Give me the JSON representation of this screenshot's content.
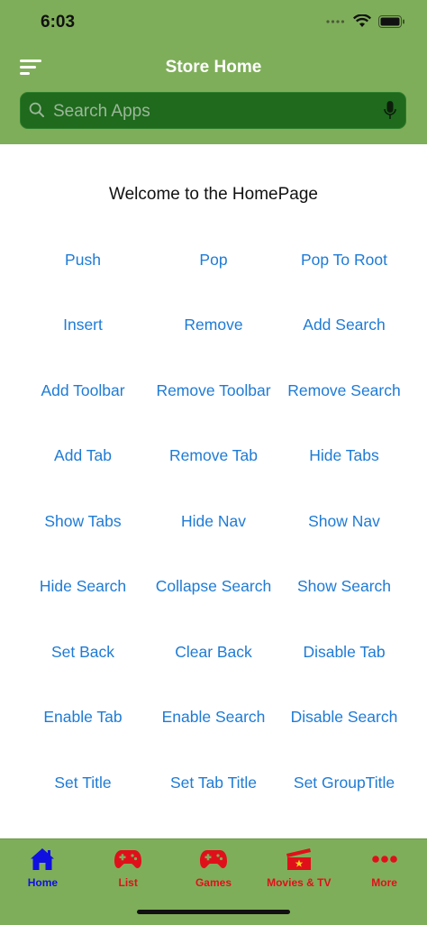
{
  "status_bar": {
    "time": "6:03"
  },
  "header": {
    "title": "Store Home",
    "search": {
      "placeholder": "Search Apps",
      "value": ""
    }
  },
  "main": {
    "welcome": "Welcome to the HomePage",
    "buttons": [
      [
        "Push",
        "Pop",
        "Pop To Root"
      ],
      [
        "Insert",
        "Remove",
        "Add Search"
      ],
      [
        "Add Toolbar",
        "Remove Toolbar",
        "Remove Search"
      ],
      [
        "Add Tab",
        "Remove Tab",
        "Hide Tabs"
      ],
      [
        "Show Tabs",
        "Hide Nav",
        "Show Nav"
      ],
      [
        "Hide Search",
        "Collapse Search",
        "Show Search"
      ],
      [
        "Set Back",
        "Clear Back",
        "Disable Tab"
      ],
      [
        "Enable Tab",
        "Enable Search",
        "Disable Search"
      ],
      [
        "Set Title",
        "Set Tab Title",
        "Set GroupTitle"
      ]
    ]
  },
  "tabs": [
    {
      "label": "Home",
      "icon": "house-icon",
      "selected": true
    },
    {
      "label": "List",
      "icon": "gamecontroller-icon",
      "selected": false
    },
    {
      "label": "Games",
      "icon": "gamecontroller-icon",
      "selected": false
    },
    {
      "label": "Movies & TV",
      "icon": "film-icon",
      "selected": false
    },
    {
      "label": "More",
      "icon": "more-icon",
      "selected": false
    }
  ],
  "colors": {
    "nav_background": "#7fae5a",
    "search_background": "#1f6a1d",
    "link_blue": "#1e7bd6",
    "tab_selected": "#1010e0",
    "tab_unselected": "#e0101a"
  }
}
